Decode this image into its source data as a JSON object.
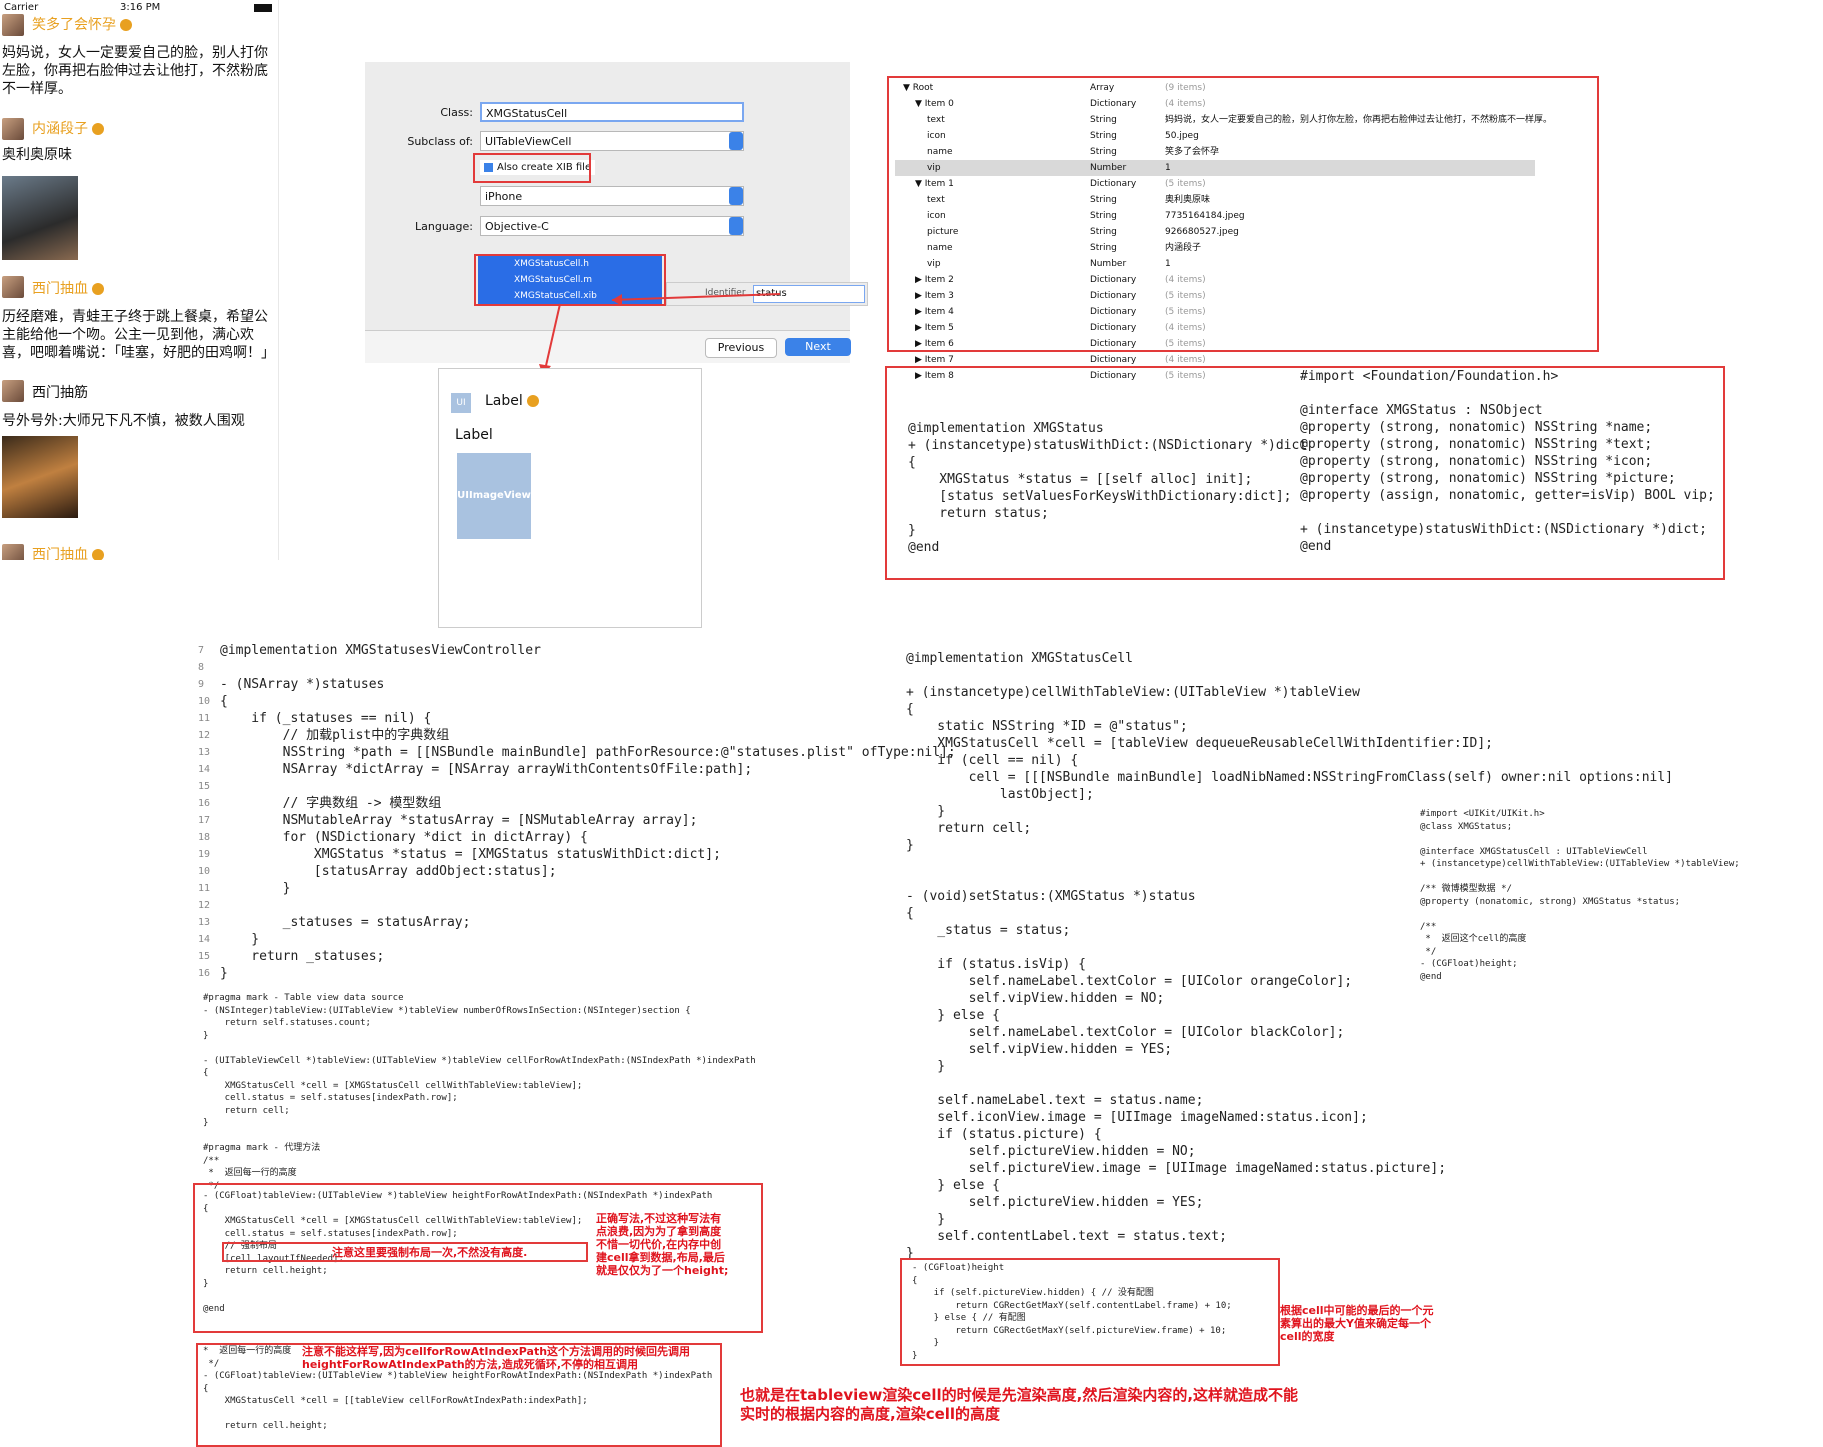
{
  "phone": {
    "status": {
      "carrier": "Carrier",
      "time": "3:16 PM"
    },
    "items": [
      {
        "name": "笑多了会怀孕",
        "vip": true,
        "text": "妈妈说，女人一定要爱自己的脸，别人打你左脸，你再把右脸伸过去让他打，不然粉底不一样厚。"
      },
      {
        "name": "内涵段子",
        "vip": true,
        "text": "奥利奥原味"
      },
      {
        "name": "西门抽血",
        "vip": true,
        "text": "历经磨难，青蛙王子终于跳上餐桌，希望公主能给他一个吻。公主一见到他，满心欢喜，吧唧着嘴说：「哇塞，好肥的田鸡啊！」"
      },
      {
        "name": "西门抽筋",
        "vip": false,
        "text": "号外号外:大师兄下凡不慎，被数人围观"
      },
      {
        "name": "西门抽血",
        "vip": true,
        "text": ""
      }
    ]
  },
  "dialog": {
    "class_label": "Class:",
    "class_value": "XMGStatusCell",
    "subclass_label": "Subclass of:",
    "subclass_value": "UITableViewCell",
    "xib_label": "Also create XIB file",
    "device_value": "iPhone",
    "language_label": "Language:",
    "language_value": "Objective-C",
    "files": [
      "XMGStatusCell.h",
      "XMGStatusCell.m",
      "XMGStatusCell.xib"
    ],
    "identifier_label": "Identifier",
    "identifier_value": "status",
    "previous": "Previous",
    "next": "Next"
  },
  "xib": {
    "label1": "Label",
    "label2": "Label",
    "image": "UIImageView",
    "ui_badge": "UI"
  },
  "plist": {
    "rows": [
      {
        "key": "Root",
        "type": "Array",
        "value": "(9 items)",
        "indent": 0,
        "toggle": "▼"
      },
      {
        "key": "Item 0",
        "type": "Dictionary",
        "value": "(4 items)",
        "indent": 1,
        "toggle": "▼"
      },
      {
        "key": "text",
        "type": "String",
        "value": "妈妈说，女人一定要爱自己的脸，别人打你左脸，你再把右脸伸过去让他打，不然粉底不一样厚。",
        "indent": 2,
        "toggle": ""
      },
      {
        "key": "icon",
        "type": "String",
        "value": "50.jpeg",
        "indent": 2,
        "toggle": ""
      },
      {
        "key": "name",
        "type": "String",
        "value": "笑多了会怀孕",
        "indent": 2,
        "toggle": ""
      },
      {
        "key": "vip",
        "type": "Number",
        "value": "1",
        "indent": 2,
        "toggle": "",
        "selected": true
      },
      {
        "key": "Item 1",
        "type": "Dictionary",
        "value": "(5 items)",
        "indent": 1,
        "toggle": "▼"
      },
      {
        "key": "text",
        "type": "String",
        "value": "奥利奥原味",
        "indent": 2,
        "toggle": ""
      },
      {
        "key": "icon",
        "type": "String",
        "value": "7735164184.jpeg",
        "indent": 2,
        "toggle": ""
      },
      {
        "key": "picture",
        "type": "String",
        "value": "926680527.jpeg",
        "indent": 2,
        "toggle": ""
      },
      {
        "key": "name",
        "type": "String",
        "value": "内涵段子",
        "indent": 2,
        "toggle": ""
      },
      {
        "key": "vip",
        "type": "Number",
        "value": "1",
        "indent": 2,
        "toggle": ""
      },
      {
        "key": "Item 2",
        "type": "Dictionary",
        "value": "(4 items)",
        "indent": 1,
        "toggle": "▶"
      },
      {
        "key": "Item 3",
        "type": "Dictionary",
        "value": "(5 items)",
        "indent": 1,
        "toggle": "▶"
      },
      {
        "key": "Item 4",
        "type": "Dictionary",
        "value": "(5 items)",
        "indent": 1,
        "toggle": "▶"
      },
      {
        "key": "Item 5",
        "type": "Dictionary",
        "value": "(4 items)",
        "indent": 1,
        "toggle": "▶"
      },
      {
        "key": "Item 6",
        "type": "Dictionary",
        "value": "(5 items)",
        "indent": 1,
        "toggle": "▶"
      },
      {
        "key": "Item 7",
        "type": "Dictionary",
        "value": "(4 items)",
        "indent": 1,
        "toggle": "▶"
      },
      {
        "key": "Item 8",
        "type": "Dictionary",
        "value": "(5 items)",
        "indent": 1,
        "toggle": "▶"
      }
    ]
  },
  "code_status_m": "@implementation XMGStatus\n+ (instancetype)statusWithDict:(NSDictionary *)dict\n{\n    XMGStatus *status = [[self alloc] init];\n    [status setValuesForKeysWithDictionary:dict];\n    return status;\n}\n@end",
  "code_status_h": "#import <Foundation/Foundation.h>\n\n@interface XMGStatus : NSObject\n@property (strong, nonatomic) NSString *name;\n@property (strong, nonatomic) NSString *text;\n@property (strong, nonatomic) NSString *icon;\n@property (strong, nonatomic) NSString *picture;\n@property (assign, nonatomic, getter=isVip) BOOL vip;\n\n+ (instancetype)statusWithDict:(NSDictionary *)dict;\n@end",
  "code_vc": "@implementation XMGStatusesViewController\n\n- (NSArray *)statuses\n{\n    if (_statuses == nil) {\n        // 加载plist中的字典数组\n        NSString *path = [[NSBundle mainBundle] pathForResource:@\"statuses.plist\" ofType:nil];\n        NSArray *dictArray = [NSArray arrayWithContentsOfFile:path];\n\n        // 字典数组 -> 模型数组\n        NSMutableArray *statusArray = [NSMutableArray array];\n        for (NSDictionary *dict in dictArray) {\n            XMGStatus *status = [XMGStatus statusWithDict:dict];\n            [statusArray addObject:status];\n        }\n\n        _statuses = statusArray;\n    }\n    return _statuses;\n}",
  "gutter_vc": "7\n8\n9\n10\n11\n12\n13\n14\n15\n16\n17\n18\n19\n10\n11\n12\n13\n14\n15\n16",
  "code_vc_small": "#pragma mark - Table view data source\n- (NSInteger)tableView:(UITableView *)tableView numberOfRowsInSection:(NSInteger)section {\n    return self.statuses.count;\n}\n\n- (UITableViewCell *)tableView:(UITableView *)tableView cellForRowAtIndexPath:(NSIndexPath *)indexPath\n{\n    XMGStatusCell *cell = [XMGStatusCell cellWithTableView:tableView];\n    cell.status = self.statuses[indexPath.row];\n    return cell;\n}\n\n#pragma mark - 代理方法\n/**\n *  返回每一行的高度\n */",
  "code_height_ok": "- (CGFloat)tableView:(UITableView *)tableView heightForRowAtIndexPath:(NSIndexPath *)indexPath\n{\n    XMGStatusCell *cell = [XMGStatusCell cellWithTableView:tableView];\n    cell.status = self.statuses[indexPath.row];\n    // 强制布局\n    [cell layoutIfNeeded];\n    return cell.height;\n}\n\n@end",
  "note_force_layout": "注意这里要强制布局一次,不然没有高度.",
  "note_correct": "正确写法,不过这种写法有点浪费,因为为了拿到高度不惜一切代价,在内存中创建cell拿到数据,布局,最后就是仅仅为了一个height;",
  "code_height_bad": "*  返回每一行的高度\n */\n- (CGFloat)tableView:(UITableView *)tableView heightForRowAtIndexPath:(NSIndexPath *)indexPath\n{\n    XMGStatusCell *cell = [[tableView cellForRowAtIndexPath:indexPath];\n\n    return cell.height;",
  "note_bad": "注意不能这样写,因为cellforRowAtIndexPath这个方法调用的时候回先调用heightForRowAtIndexPath的方法,造成死循环,不停的相互调用",
  "note_bottom": "也就是在tableview渲染cell的时候是先渲染高度,然后渲染内容的,这样就造成不能实时的根据内容的高度,渲染cell的高度",
  "code_cell": "@implementation XMGStatusCell\n\n+ (instancetype)cellWithTableView:(UITableView *)tableView\n{\n    static NSString *ID = @\"status\";\n    XMGStatusCell *cell = [tableView dequeueReusableCellWithIdentifier:ID];\n    if (cell == nil) {\n        cell = [[[NSBundle mainBundle] loadNibNamed:NSStringFromClass(self) owner:nil options:nil]\n            lastObject];\n    }\n    return cell;\n}\n\n\n- (void)setStatus:(XMGStatus *)status\n{\n    _status = status;\n\n    if (status.isVip) {\n        self.nameLabel.textColor = [UIColor orangeColor];\n        self.vipView.hidden = NO;\n    } else {\n        self.nameLabel.textColor = [UIColor blackColor];\n        self.vipView.hidden = YES;\n    }\n\n    self.nameLabel.text = status.name;\n    self.iconView.image = [UIImage imageNamed:status.icon];\n    if (status.picture) {\n        self.pictureView.hidden = NO;\n        self.pictureView.image = [UIImage imageNamed:status.picture];\n    } else {\n        self.pictureView.hidden = YES;\n    }\n    self.contentLabel.text = status.text;\n}",
  "code_cell_h": "#import <UIKit/UIKit.h>\n@class XMGStatus;\n\n@interface XMGStatusCell : UITableViewCell\n+ (instancetype)cellWithTableView:(UITableView *)tableView;\n\n/** 微博模型数据 */\n@property (nonatomic, strong) XMGStatus *status;\n\n/**\n *  返回这个cell的高度\n */\n- (CGFloat)height;\n@end",
  "code_height_impl": "- (CGFloat)height\n{\n    if (self.pictureView.hidden) { // 没有配图\n        return CGRectGetMaxY(self.contentLabel.frame) + 10;\n    } else { // 有配图\n        return CGRectGetMaxY(self.pictureView.frame) + 10;\n    }\n}",
  "note_height": "根据cell中可能的最后的一个元素算出的最大Y值来确定每一个cell的宽度",
  "colors": {
    "annotation_red": "#e23a3a",
    "xcode_blue": "#2a6de6",
    "vip_orange": "#e8a020"
  }
}
